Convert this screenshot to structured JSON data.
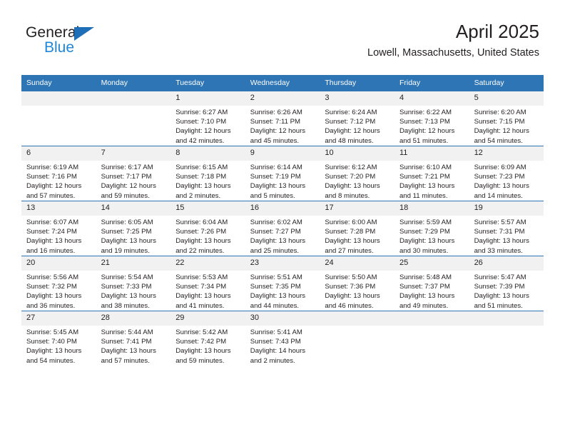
{
  "brand": {
    "name_part1": "General",
    "name_part2": "Blue",
    "logo_icon": "triangle-logo-icon",
    "accent_color": "#1e6fb8",
    "secondary_color": "#1f86d8"
  },
  "header": {
    "title": "April 2025",
    "subtitle": "Lowell, Massachusetts, United States"
  },
  "calendar": {
    "header_background": "#2e75b6",
    "daynum_background": "#f1f1f1",
    "weekday_headers": [
      "Sunday",
      "Monday",
      "Tuesday",
      "Wednesday",
      "Thursday",
      "Friday",
      "Saturday"
    ],
    "weeks": [
      [
        {
          "day": "",
          "empty": true,
          "sunrise": "",
          "sunset": "",
          "daylight_line1": "",
          "daylight_line2": ""
        },
        {
          "day": "",
          "empty": true,
          "sunrise": "",
          "sunset": "",
          "daylight_line1": "",
          "daylight_line2": ""
        },
        {
          "day": "1",
          "sunrise": "Sunrise: 6:27 AM",
          "sunset": "Sunset: 7:10 PM",
          "daylight_line1": "Daylight: 12 hours",
          "daylight_line2": "and 42 minutes."
        },
        {
          "day": "2",
          "sunrise": "Sunrise: 6:26 AM",
          "sunset": "Sunset: 7:11 PM",
          "daylight_line1": "Daylight: 12 hours",
          "daylight_line2": "and 45 minutes."
        },
        {
          "day": "3",
          "sunrise": "Sunrise: 6:24 AM",
          "sunset": "Sunset: 7:12 PM",
          "daylight_line1": "Daylight: 12 hours",
          "daylight_line2": "and 48 minutes."
        },
        {
          "day": "4",
          "sunrise": "Sunrise: 6:22 AM",
          "sunset": "Sunset: 7:13 PM",
          "daylight_line1": "Daylight: 12 hours",
          "daylight_line2": "and 51 minutes."
        },
        {
          "day": "5",
          "sunrise": "Sunrise: 6:20 AM",
          "sunset": "Sunset: 7:15 PM",
          "daylight_line1": "Daylight: 12 hours",
          "daylight_line2": "and 54 minutes."
        }
      ],
      [
        {
          "day": "6",
          "sunrise": "Sunrise: 6:19 AM",
          "sunset": "Sunset: 7:16 PM",
          "daylight_line1": "Daylight: 12 hours",
          "daylight_line2": "and 57 minutes."
        },
        {
          "day": "7",
          "sunrise": "Sunrise: 6:17 AM",
          "sunset": "Sunset: 7:17 PM",
          "daylight_line1": "Daylight: 12 hours",
          "daylight_line2": "and 59 minutes."
        },
        {
          "day": "8",
          "sunrise": "Sunrise: 6:15 AM",
          "sunset": "Sunset: 7:18 PM",
          "daylight_line1": "Daylight: 13 hours",
          "daylight_line2": "and 2 minutes."
        },
        {
          "day": "9",
          "sunrise": "Sunrise: 6:14 AM",
          "sunset": "Sunset: 7:19 PM",
          "daylight_line1": "Daylight: 13 hours",
          "daylight_line2": "and 5 minutes."
        },
        {
          "day": "10",
          "sunrise": "Sunrise: 6:12 AM",
          "sunset": "Sunset: 7:20 PM",
          "daylight_line1": "Daylight: 13 hours",
          "daylight_line2": "and 8 minutes."
        },
        {
          "day": "11",
          "sunrise": "Sunrise: 6:10 AM",
          "sunset": "Sunset: 7:21 PM",
          "daylight_line1": "Daylight: 13 hours",
          "daylight_line2": "and 11 minutes."
        },
        {
          "day": "12",
          "sunrise": "Sunrise: 6:09 AM",
          "sunset": "Sunset: 7:23 PM",
          "daylight_line1": "Daylight: 13 hours",
          "daylight_line2": "and 14 minutes."
        }
      ],
      [
        {
          "day": "13",
          "sunrise": "Sunrise: 6:07 AM",
          "sunset": "Sunset: 7:24 PM",
          "daylight_line1": "Daylight: 13 hours",
          "daylight_line2": "and 16 minutes."
        },
        {
          "day": "14",
          "sunrise": "Sunrise: 6:05 AM",
          "sunset": "Sunset: 7:25 PM",
          "daylight_line1": "Daylight: 13 hours",
          "daylight_line2": "and 19 minutes."
        },
        {
          "day": "15",
          "sunrise": "Sunrise: 6:04 AM",
          "sunset": "Sunset: 7:26 PM",
          "daylight_line1": "Daylight: 13 hours",
          "daylight_line2": "and 22 minutes."
        },
        {
          "day": "16",
          "sunrise": "Sunrise: 6:02 AM",
          "sunset": "Sunset: 7:27 PM",
          "daylight_line1": "Daylight: 13 hours",
          "daylight_line2": "and 25 minutes."
        },
        {
          "day": "17",
          "sunrise": "Sunrise: 6:00 AM",
          "sunset": "Sunset: 7:28 PM",
          "daylight_line1": "Daylight: 13 hours",
          "daylight_line2": "and 27 minutes."
        },
        {
          "day": "18",
          "sunrise": "Sunrise: 5:59 AM",
          "sunset": "Sunset: 7:29 PM",
          "daylight_line1": "Daylight: 13 hours",
          "daylight_line2": "and 30 minutes."
        },
        {
          "day": "19",
          "sunrise": "Sunrise: 5:57 AM",
          "sunset": "Sunset: 7:31 PM",
          "daylight_line1": "Daylight: 13 hours",
          "daylight_line2": "and 33 minutes."
        }
      ],
      [
        {
          "day": "20",
          "sunrise": "Sunrise: 5:56 AM",
          "sunset": "Sunset: 7:32 PM",
          "daylight_line1": "Daylight: 13 hours",
          "daylight_line2": "and 36 minutes."
        },
        {
          "day": "21",
          "sunrise": "Sunrise: 5:54 AM",
          "sunset": "Sunset: 7:33 PM",
          "daylight_line1": "Daylight: 13 hours",
          "daylight_line2": "and 38 minutes."
        },
        {
          "day": "22",
          "sunrise": "Sunrise: 5:53 AM",
          "sunset": "Sunset: 7:34 PM",
          "daylight_line1": "Daylight: 13 hours",
          "daylight_line2": "and 41 minutes."
        },
        {
          "day": "23",
          "sunrise": "Sunrise: 5:51 AM",
          "sunset": "Sunset: 7:35 PM",
          "daylight_line1": "Daylight: 13 hours",
          "daylight_line2": "and 44 minutes."
        },
        {
          "day": "24",
          "sunrise": "Sunrise: 5:50 AM",
          "sunset": "Sunset: 7:36 PM",
          "daylight_line1": "Daylight: 13 hours",
          "daylight_line2": "and 46 minutes."
        },
        {
          "day": "25",
          "sunrise": "Sunrise: 5:48 AM",
          "sunset": "Sunset: 7:37 PM",
          "daylight_line1": "Daylight: 13 hours",
          "daylight_line2": "and 49 minutes."
        },
        {
          "day": "26",
          "sunrise": "Sunrise: 5:47 AM",
          "sunset": "Sunset: 7:39 PM",
          "daylight_line1": "Daylight: 13 hours",
          "daylight_line2": "and 51 minutes."
        }
      ],
      [
        {
          "day": "27",
          "sunrise": "Sunrise: 5:45 AM",
          "sunset": "Sunset: 7:40 PM",
          "daylight_line1": "Daylight: 13 hours",
          "daylight_line2": "and 54 minutes."
        },
        {
          "day": "28",
          "sunrise": "Sunrise: 5:44 AM",
          "sunset": "Sunset: 7:41 PM",
          "daylight_line1": "Daylight: 13 hours",
          "daylight_line2": "and 57 minutes."
        },
        {
          "day": "29",
          "sunrise": "Sunrise: 5:42 AM",
          "sunset": "Sunset: 7:42 PM",
          "daylight_line1": "Daylight: 13 hours",
          "daylight_line2": "and 59 minutes."
        },
        {
          "day": "30",
          "sunrise": "Sunrise: 5:41 AM",
          "sunset": "Sunset: 7:43 PM",
          "daylight_line1": "Daylight: 14 hours",
          "daylight_line2": "and 2 minutes."
        },
        {
          "day": "",
          "empty": true,
          "sunrise": "",
          "sunset": "",
          "daylight_line1": "",
          "daylight_line2": ""
        },
        {
          "day": "",
          "empty": true,
          "sunrise": "",
          "sunset": "",
          "daylight_line1": "",
          "daylight_line2": ""
        },
        {
          "day": "",
          "empty": true,
          "sunrise": "",
          "sunset": "",
          "daylight_line1": "",
          "daylight_line2": ""
        }
      ]
    ]
  }
}
